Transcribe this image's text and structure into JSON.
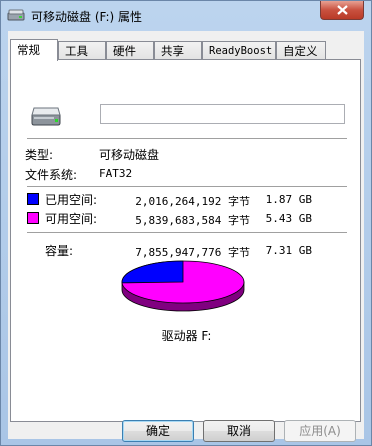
{
  "window": {
    "title": "可移动磁盘 (F:) 属性",
    "close_icon": "close-x-icon"
  },
  "tabs": [
    {
      "label": "常规",
      "active": true
    },
    {
      "label": "工具",
      "active": false
    },
    {
      "label": "硬件",
      "active": false
    },
    {
      "label": "共享",
      "active": false
    },
    {
      "label": "ReadyBoost",
      "active": false
    },
    {
      "label": "自定义",
      "active": false
    }
  ],
  "general": {
    "drive_icon": "removable-drive-icon",
    "name_value": "",
    "type_label": "类型:",
    "type_value": "可移动磁盘",
    "fs_label": "文件系统:",
    "fs_value": "FAT32",
    "used_label": "已用空间:",
    "used_bytes": "2,016,264,192 字节",
    "used_size": "1.87 GB",
    "free_label": "可用空间:",
    "free_bytes": "5,839,683,584 字节",
    "free_size": "5.43 GB",
    "capacity_label": "容量:",
    "capacity_bytes": "7,855,947,776 字节",
    "capacity_size": "7.31 GB",
    "drive_label": "驱动器 F:",
    "used_fraction": 0.2567,
    "colors": {
      "used": "#0000ff",
      "free": "#ff00ff"
    }
  },
  "buttons": {
    "ok": "确定",
    "cancel": "取消",
    "apply": "应用(A)"
  }
}
